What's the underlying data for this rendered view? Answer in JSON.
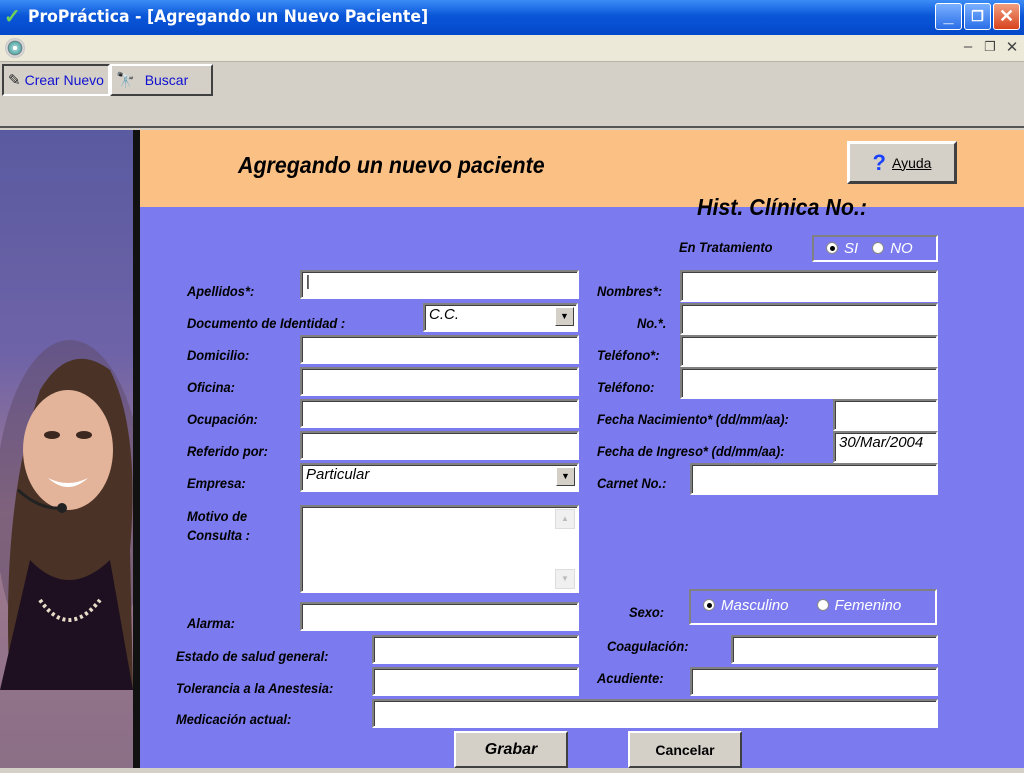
{
  "window": {
    "title": "ProPráctica - [Agregando un Nuevo Paciente]"
  },
  "toolbar": {
    "new_label": "Crear Nuevo",
    "search_label": "Buscar"
  },
  "form": {
    "heading": "Agregando un nuevo paciente",
    "help_label": "Ayuda",
    "history_label": "Hist. Clínica No.:",
    "treatment": {
      "label": "En Tratamiento",
      "yes": "SI",
      "no": "NO",
      "selected": "SI"
    },
    "fields": {
      "apellidos": "Apellidos*:",
      "documento": "Documento de Identidad :",
      "domicilio": "Domicilio:",
      "oficina": "Oficina:",
      "ocupacion": "Ocupación:",
      "referido": "Referido por:",
      "empresa": "Empresa:",
      "motivo": "Motivo de",
      "motivo2": "Consulta :",
      "alarma": "Alarma:",
      "estado_salud": "Estado de salud general:",
      "tolerancia": "Tolerancia a la Anestesia:",
      "medicacion": "Medicación actual:",
      "nombres": "Nombres*:",
      "no": "No.*.",
      "telefono1": "Teléfono*:",
      "telefono2": "Teléfono:",
      "fecha_nac": "Fecha Nacimiento* (dd/mm/aa):",
      "fecha_ingreso": "Fecha de Ingreso* (dd/mm/aa):",
      "carnet": "Carnet No.:",
      "sexo": "Sexo:",
      "coagulacion": "Coagulación:",
      "acudiente": "Acudiente:"
    },
    "values": {
      "documento_tipo": "C.C.",
      "empresa": "Particular",
      "fecha_ingreso": "30/Mar/2004"
    },
    "sexo": {
      "masculino": "Masculino",
      "femenino": "Femenino",
      "selected": "Masculino"
    },
    "buttons": {
      "save": "Grabar",
      "cancel": "Cancelar"
    }
  },
  "colors": {
    "form_bg": "#7b7bef",
    "header_bg": "#fbc083",
    "titlebar": "#0a56d8"
  },
  "icons": {
    "app": "checkmark-icon",
    "mdi": "disc-icon",
    "new": "pen-icon",
    "search": "binoculars-icon",
    "help": "question-icon"
  }
}
